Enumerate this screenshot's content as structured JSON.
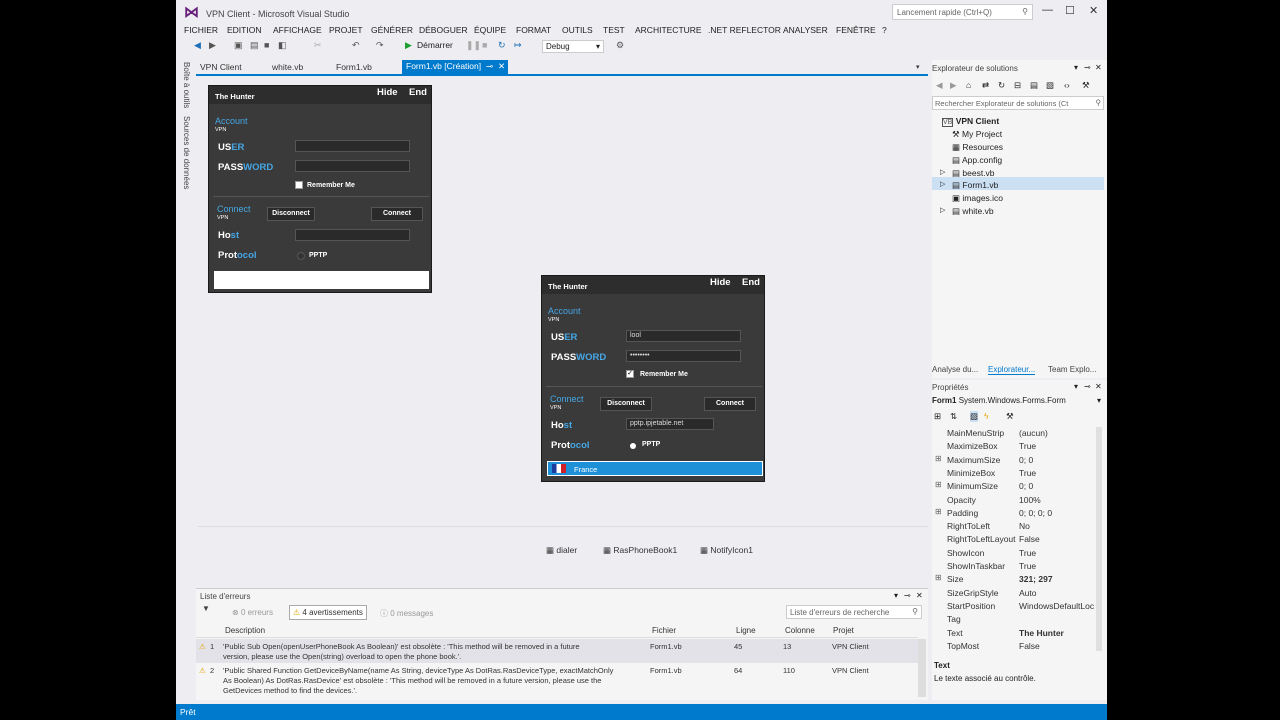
{
  "window": {
    "title": "VPN Client - Microsoft Visual Studio",
    "quick_launch": "Lancement rapide (Ctrl+Q)"
  },
  "menu": [
    "FICHIER",
    "EDITION",
    "AFFICHAGE",
    "PROJET",
    "GÉNÉRER",
    "DÉBOGUER",
    "ÉQUIPE",
    "FORMAT",
    "OUTILS",
    "TEST",
    "ARCHITECTURE",
    ".NET REFLECTOR",
    "ANALYSER",
    "FENÊTRE",
    "?"
  ],
  "toolbar": {
    "start": "Démarrer",
    "config": "Debug"
  },
  "left_strip": [
    "Boîte à outils",
    "Sources de données"
  ],
  "tabs": [
    "VPN Client",
    "white.vb",
    "Form1.vb",
    "Form1.vb [Création]"
  ],
  "form_design": {
    "title": "The Hunter",
    "hide": "Hide",
    "end": "End",
    "account": "Account",
    "vpn": "VPN",
    "user_a": "US",
    "user_b": "ER",
    "pass_a": "PASS",
    "pass_b": "WORD",
    "remember": "Remember Me",
    "connect": "Connect",
    "disconnect": "Disconnect",
    "connect_btn": "Connect",
    "host_a": "Ho",
    "host_b": "st",
    "proto_a": "Prot",
    "proto_b": "ocol",
    "pptp": "PPTP"
  },
  "form_run": {
    "title": "The Hunter",
    "hide": "Hide",
    "end": "End",
    "account": "Account",
    "vpn": "VPN",
    "user_a": "US",
    "user_b": "ER",
    "pass_a": "PASS",
    "pass_b": "WORD",
    "user_value": "lool",
    "pass_value": "••••••••",
    "remember": "Remember Me",
    "connect": "Connect",
    "disconnect": "Disconnect",
    "connect_btn": "Connect",
    "host_a": "Ho",
    "host_b": "st",
    "host_value": "pptp.ipjetable.net",
    "proto_a": "Prot",
    "proto_b": "ocol",
    "pptp": "PPTP",
    "country": "France"
  },
  "tray": [
    "dialer",
    "RasPhoneBook1",
    "NotifyIcon1"
  ],
  "errors": {
    "title": "Liste d'erreurs",
    "errors_btn": "0 erreurs",
    "warnings_btn": "4 avertissements",
    "messages_btn": "0 messages",
    "search": "Liste d'erreurs de recherche",
    "cols": [
      "Description",
      "Fichier",
      "Ligne",
      "Colonne",
      "Projet"
    ],
    "rows": [
      {
        "n": "1",
        "d1": "'Public Sub Open(openUserPhoneBook As Boolean)' est obsolète : 'This method will be removed in a future",
        "d2": "version, please use the Open(string) overload to open the phone book.'.",
        "d3": "",
        "file": "Form1.vb",
        "line": "45",
        "col": "13",
        "proj": "VPN Client"
      },
      {
        "n": "2",
        "d1": "'Public Shared Function GetDeviceByName(name As String, deviceType As DotRas.RasDeviceType, exactMatchOnly",
        "d2": "As Boolean) As DotRas.RasDevice' est obsolète : 'This method will be removed in a future version, please use the",
        "d3": "GetDevices method to find the devices.'.",
        "file": "Form1.vb",
        "line": "64",
        "col": "110",
        "proj": "VPN Client"
      }
    ]
  },
  "solution": {
    "title": "Explorateur de solutions",
    "search": "Rechercher Explorateur de solutions (Ct",
    "items": [
      "VPN Client",
      "My Project",
      "Resources",
      "App.config",
      "beest.vb",
      "Form1.vb",
      "images.ico",
      "white.vb"
    ],
    "bottom_tabs": [
      "Analyse du...",
      "Explorateur...",
      "Team Explo..."
    ]
  },
  "properties": {
    "title": "Propriétés",
    "object": "Form1",
    "type": "System.Windows.Forms.Form",
    "rows": [
      {
        "n": "MainMenuStrip",
        "v": "(aucun)"
      },
      {
        "n": "MaximizeBox",
        "v": "True"
      },
      {
        "n": "MaximumSize",
        "v": "0; 0",
        "e": true
      },
      {
        "n": "MinimizeBox",
        "v": "True"
      },
      {
        "n": "MinimumSize",
        "v": "0; 0",
        "e": true
      },
      {
        "n": "Opacity",
        "v": "100%"
      },
      {
        "n": "Padding",
        "v": "0; 0; 0; 0",
        "e": true
      },
      {
        "n": "RightToLeft",
        "v": "No"
      },
      {
        "n": "RightToLeftLayout",
        "v": "False"
      },
      {
        "n": "ShowIcon",
        "v": "True"
      },
      {
        "n": "ShowInTaskbar",
        "v": "True"
      },
      {
        "n": "Size",
        "v": "321; 297",
        "e": true,
        "b": true
      },
      {
        "n": "SizeGripStyle",
        "v": "Auto"
      },
      {
        "n": "StartPosition",
        "v": "WindowsDefaultLoc"
      },
      {
        "n": "Tag",
        "v": ""
      },
      {
        "n": "Text",
        "v": "The Hunter",
        "b": true
      },
      {
        "n": "TopMost",
        "v": "False"
      }
    ],
    "desc_title": "Text",
    "desc": "Le texte associé au contrôle."
  },
  "status": "Prêt"
}
